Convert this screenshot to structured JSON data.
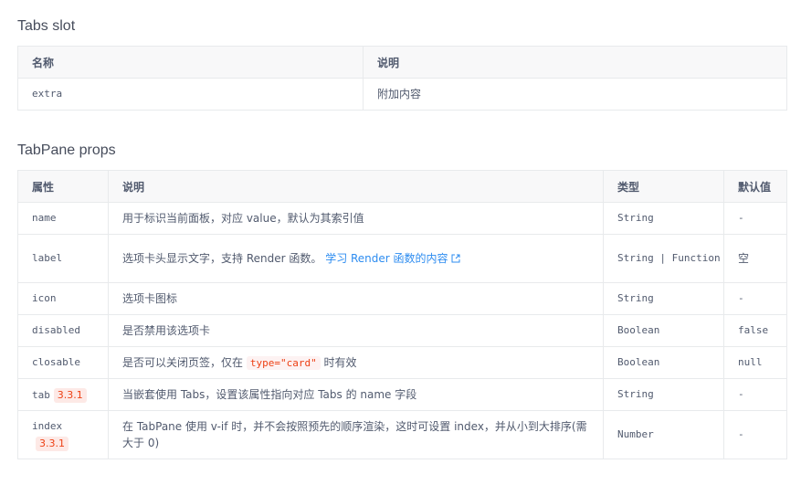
{
  "slot_section": {
    "title": "Tabs slot",
    "headers": [
      "名称",
      "说明"
    ],
    "rows": [
      {
        "name": "extra",
        "desc": "附加内容"
      }
    ]
  },
  "props_section": {
    "title": "TabPane props",
    "headers": [
      "属性",
      "说明",
      "类型",
      "默认值"
    ],
    "rows": [
      {
        "attr": "name",
        "desc": "用于标识当前面板，对应 value，默认为其索引值",
        "type": "String",
        "default": "-"
      },
      {
        "attr": "label",
        "desc_prefix": "选项卡头显示文字，支持 Render 函数。",
        "link_text": "学习 Render 函数的内容",
        "type": "String | Function",
        "default": "空"
      },
      {
        "attr": "icon",
        "desc": "选项卡图标",
        "type": "String",
        "default": "-"
      },
      {
        "attr": "disabled",
        "desc": "是否禁用该选项卡",
        "type": "Boolean",
        "default": "false"
      },
      {
        "attr": "closable",
        "desc_prefix": "是否可以关闭页签，仅在",
        "code": "type=\"card\"",
        "desc_suffix": "时有效",
        "type": "Boolean",
        "default": "null"
      },
      {
        "attr": "tab",
        "version": "3.3.1",
        "desc": "当嵌套使用 Tabs，设置该属性指向对应 Tabs 的 name 字段",
        "type": "String",
        "default": "-"
      },
      {
        "attr": "index",
        "version": "3.3.1",
        "desc": "在 TabPane 使用 v-if 时，并不会按照预先的顺序渲染，这时可设置 index，并从小到大排序(需大于 0)",
        "type": "Number",
        "default": "-"
      }
    ]
  },
  "icons": {
    "external_link": "external-link-icon"
  },
  "colors": {
    "link": "#2d8cf0",
    "code_text": "#ed4014",
    "header_bg": "#f8f8f9",
    "border": "#e8eaec"
  }
}
